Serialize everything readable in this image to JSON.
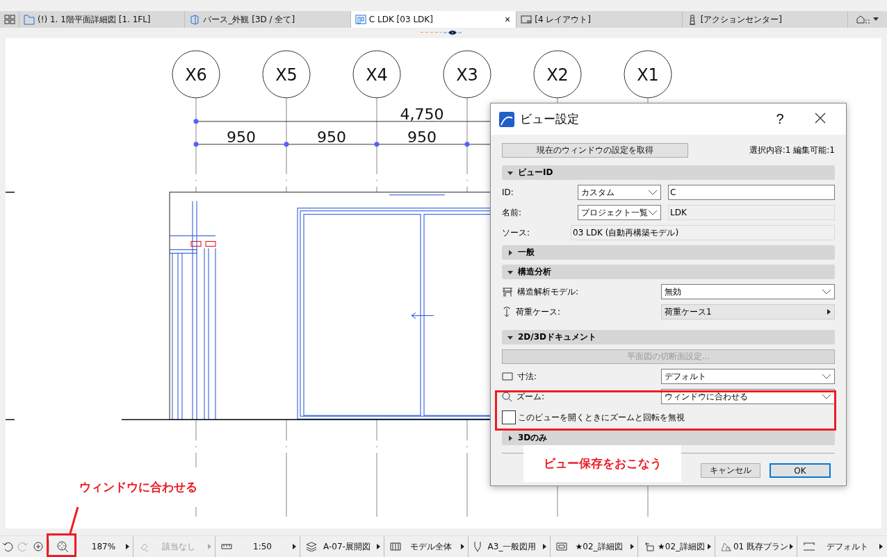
{
  "tabs": [
    {
      "kind": "plan",
      "label": "(!) 1. 1階平面詳細図 [1. 1FL]",
      "selected": false
    },
    {
      "kind": "perspective",
      "label": "パース_外観 [3D / 全て]",
      "selected": false
    },
    {
      "kind": "elevation",
      "label": "C LDK [03 LDK]",
      "selected": true,
      "close": "×"
    },
    {
      "kind": "layout",
      "label": "[4 レイアウト]",
      "selected": false
    },
    {
      "kind": "action",
      "label": "[アクションセンター]",
      "selected": false
    }
  ],
  "drawing": {
    "grid_labels": [
      "X6",
      "X5",
      "X4",
      "X3",
      "X2",
      "X1"
    ],
    "overall_dimension": "4,750",
    "span_dimensions": [
      "950",
      "950",
      "950"
    ]
  },
  "dialog": {
    "title": "ビュー設定",
    "help": "?",
    "fetch_button": "現在のウィンドウの設定を取得",
    "selection_info": "選択内容:1 編集可能:1",
    "view_id": {
      "label": "ビューID",
      "expanded": true,
      "id_label": "ID:",
      "id_select": "カスタム",
      "id_value": "C",
      "name_label": "名前:",
      "name_select": "プロジェクト一覧",
      "name_value": "LDK",
      "source_label": "ソース:",
      "source_value": "03 LDK (自動再構築モデル)"
    },
    "general": {
      "label": "一般",
      "expanded": false
    },
    "structural": {
      "label": "構造分析",
      "expanded": true,
      "rows": [
        {
          "kind": "select",
          "label": "構造解析モデル:",
          "value": "無効"
        },
        {
          "kind": "submenu",
          "label": "荷重ケース:",
          "value": "荷重ケース1"
        }
      ]
    },
    "document": {
      "label": "2D/3Dドキュメント",
      "expanded": true,
      "button": "平面図の切断面設定...",
      "button_disabled": true,
      "rows": [
        {
          "kind": "select",
          "label": "寸法:",
          "value": "デフォルト"
        },
        {
          "kind": "select",
          "label": "ズーム:",
          "value": "ウィンドウに合わせる"
        }
      ],
      "checkbox": {
        "label": "このビューを開くときにズームと回転を無視",
        "checked": false
      }
    },
    "only3d": {
      "label": "3Dのみ",
      "expanded": false
    },
    "cancel": "キャンセル",
    "ok": "OK"
  },
  "annotations": [
    {
      "text": "ビュー保存をおこなう"
    },
    {
      "text": "ウィンドウに合わせる"
    }
  ],
  "status_bar": {
    "items": [
      {
        "kind": "zoom",
        "text": "187%",
        "disabled": false
      },
      {
        "kind": "orientation",
        "text": "該当なし",
        "disabled": true
      },
      {
        "kind": "scale",
        "text": "1:50",
        "disabled": false
      },
      {
        "kind": "layers",
        "text": "A-07-展開図",
        "disabled": false
      },
      {
        "kind": "model",
        "text": "モデル全体",
        "disabled": false
      },
      {
        "kind": "pen",
        "text": "A3_一般図用",
        "disabled": false
      },
      {
        "kind": "display",
        "text": "★02_詳細図",
        "disabled": false
      },
      {
        "kind": "override",
        "text": "★02_詳細図",
        "disabled": false
      },
      {
        "kind": "renovation",
        "text": "01 既存プラン",
        "disabled": false
      },
      {
        "kind": "dimension",
        "text": "デフォルト",
        "disabled": false
      }
    ]
  }
}
